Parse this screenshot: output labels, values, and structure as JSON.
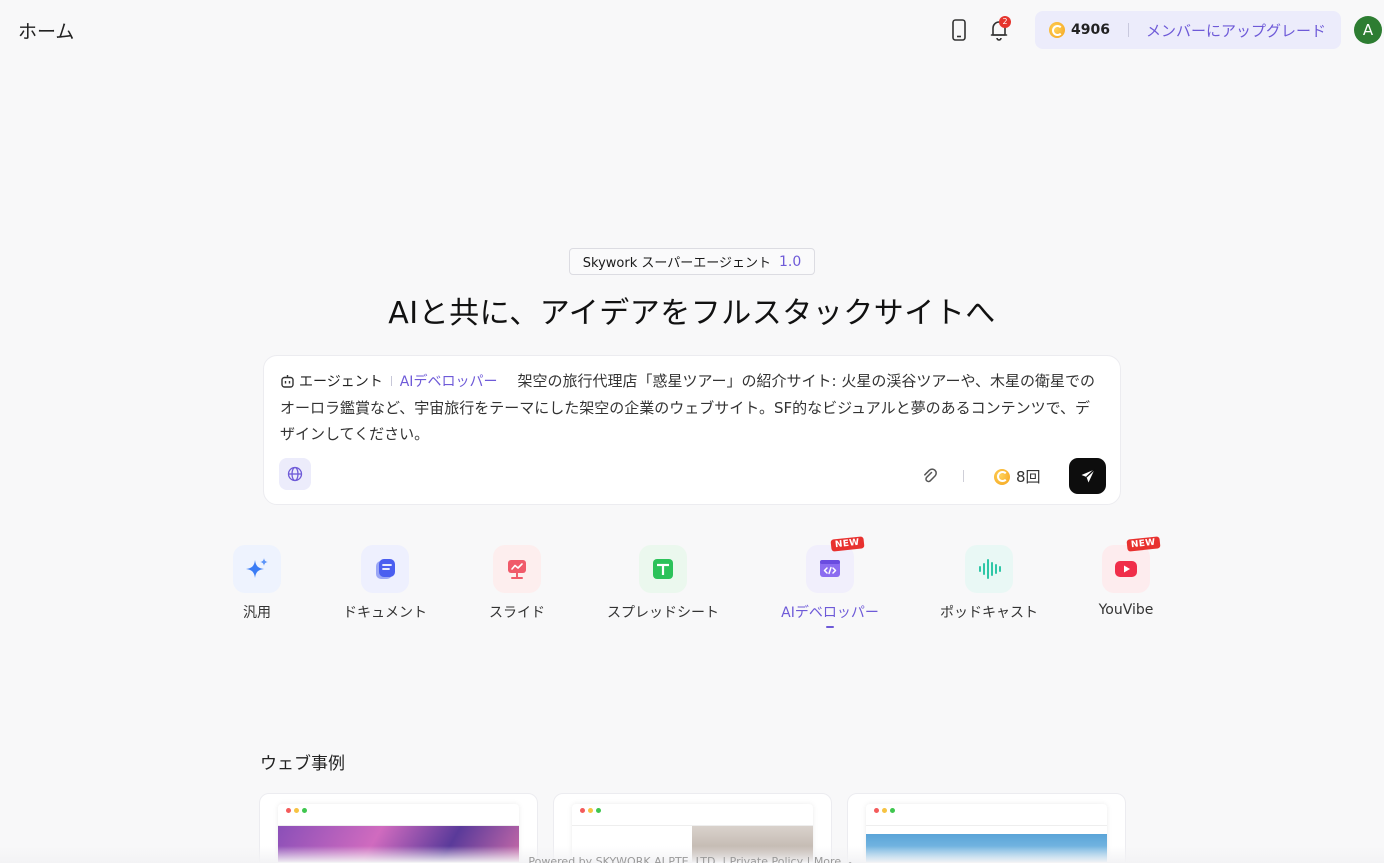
{
  "header": {
    "title": "ホーム",
    "notification_count": "2",
    "credits": "4906",
    "upgrade_label": "メンバーにアップグレード",
    "avatar_initial": "A"
  },
  "hero": {
    "product_name": "Skywork スーパーエージェント",
    "version": "1.0",
    "headline": "AIと共に、アイデアをフルスタックサイトへ"
  },
  "prompt": {
    "mode_label": "エージェント",
    "agent_label": "AIデベロッパー",
    "text": "架空の旅行代理店「惑星ツアー」の紹介サイト: 火星の渓谷ツアーや、木星の衛星でのオーロラ鑑賞など、宇宙旅行をテーマにした架空の企業のウェブサイト。SF的なビジュアルと夢のあるコンテンツで、デザインしてください。",
    "cost_label": "8回"
  },
  "tools": [
    {
      "label": "汎用"
    },
    {
      "label": "ドキュメント"
    },
    {
      "label": "スライド"
    },
    {
      "label": "スプレッドシート"
    },
    {
      "label": "AIデベロッパー",
      "badge": "NEW"
    },
    {
      "label": "ポッドキャスト"
    },
    {
      "label": "YouVibe",
      "badge": "NEW"
    }
  ],
  "examples": {
    "title": "ウェブ事例"
  },
  "footer": {
    "text": "Powered by SKYWORK AI PTE. LTD. | Private Policy | More ︿"
  },
  "colors": {
    "accent": "#6e5ad8",
    "badge_red": "#e8312f",
    "send_button": "#0d0d0d"
  }
}
